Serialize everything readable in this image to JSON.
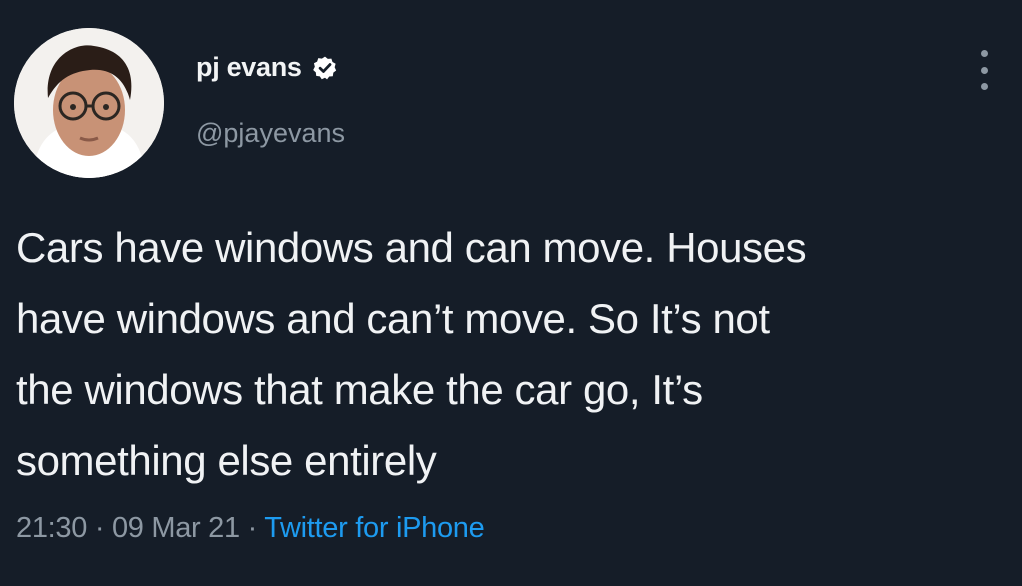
{
  "user": {
    "display_name": "pj evans",
    "handle": "@pjayevans",
    "verified": true
  },
  "tweet": {
    "lines": [
      "Cars have windows and can move. Houses",
      "have windows and can’t move. So It’s not",
      "the windows that make the car go, It’s",
      "something else entirely"
    ],
    "time": "21:30",
    "separator": " · ",
    "date": "09 Mar 21",
    "source": "Twitter for iPhone"
  },
  "icons": {
    "verified": "verified-badge-icon",
    "more": "more-options-icon"
  },
  "colors": {
    "background": "#151d28",
    "text": "#f0f2f4",
    "secondary": "#8d98a3",
    "link": "#1d9bf0"
  }
}
